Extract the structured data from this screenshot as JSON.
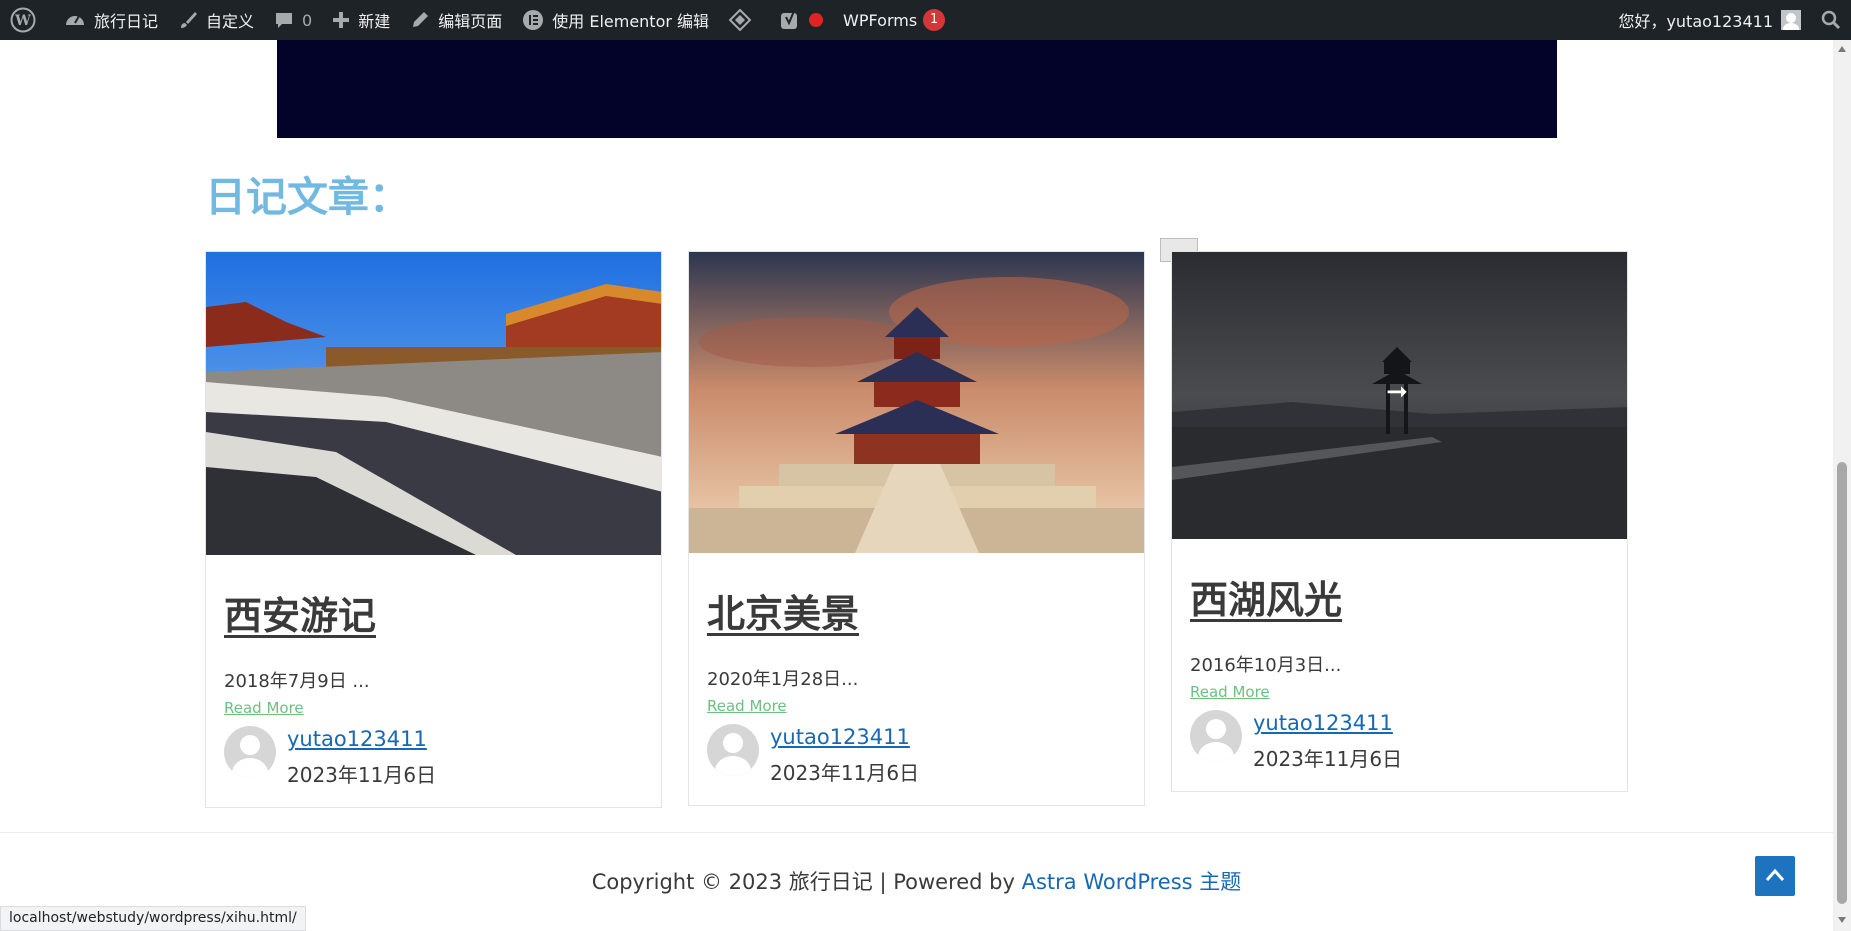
{
  "adminbar": {
    "site_name": "旅行日记",
    "customize": "自定义",
    "comments_count": "0",
    "new": "新建",
    "edit_page": "编辑页面",
    "elementor": "使用 Elementor 编辑",
    "wpforms": "WPForms",
    "wpforms_badge": "1",
    "greeting": "您好，yutao123411"
  },
  "section": {
    "title": "日记文章："
  },
  "posts": [
    {
      "title": "西安游记",
      "excerpt": "2018年7月9日 ...",
      "read_more": "Read More",
      "author": "yutao123411",
      "date": "2023年11月6日"
    },
    {
      "title": "北京美景",
      "excerpt": "2020年1月28日...",
      "read_more": "Read More",
      "author": "yutao123411",
      "date": "2023年11月6日"
    },
    {
      "title": "西湖风光",
      "excerpt": "2016年10月3日...",
      "read_more": "Read More",
      "author": "yutao123411",
      "date": "2023年11月6日"
    }
  ],
  "footer": {
    "copyright": "Copyright © 2023 旅行日记 | Powered by ",
    "theme_link": "Astra WordPress 主题"
  },
  "status_bar": {
    "url": "localhost/webstudy/wordpress/xihu.html/"
  },
  "colors": {
    "accent": "#1e73be",
    "title_blue": "#72b9e2",
    "read_more_green": "#6cc080",
    "adminbar_bg": "#1d2327"
  }
}
